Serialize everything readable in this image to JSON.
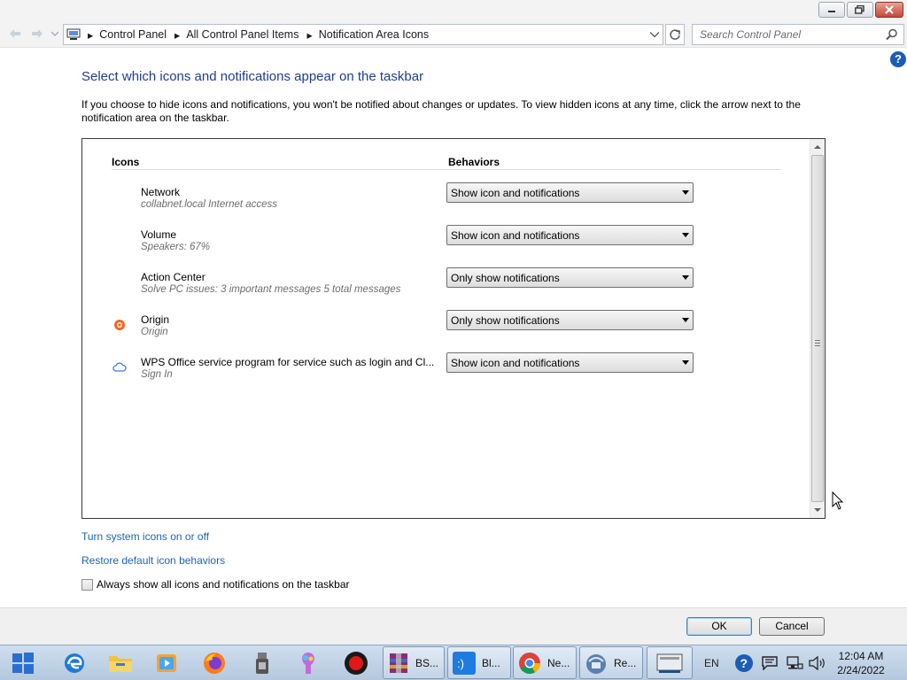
{
  "window": {
    "controls": [
      "minimize",
      "maximize",
      "close"
    ]
  },
  "address_bar": {
    "breadcrumbs": [
      "Control Panel",
      "All Control Panel Items",
      "Notification Area Icons"
    ],
    "search_placeholder": "Search Control Panel"
  },
  "help_label": "?",
  "page": {
    "heading": "Select which icons and notifications appear on the taskbar",
    "description": "If you choose to hide icons and notifications, you won't be notified about changes or updates. To view hidden icons at any time, click the arrow next to the notification area on the taskbar."
  },
  "table": {
    "col_icons": "Icons",
    "col_behaviors": "Behaviors",
    "rows": [
      {
        "name": "Network",
        "sub": "collabnet.local Internet access",
        "behavior": "Show icon and notifications",
        "icon": "none"
      },
      {
        "name": "Volume",
        "sub": "Speakers: 67%",
        "behavior": "Show icon and notifications",
        "icon": "none"
      },
      {
        "name": "Action Center",
        "sub": "Solve PC issues: 3 important messages  5 total messages",
        "behavior": "Only show notifications",
        "icon": "none"
      },
      {
        "name": "Origin",
        "sub": "Origin",
        "behavior": "Only show notifications",
        "icon": "origin-icon"
      },
      {
        "name": "WPS Office service program for service such as login and Cl...",
        "sub": "Sign In",
        "behavior": "Show icon and notifications",
        "icon": "cloud-icon"
      }
    ]
  },
  "links": {
    "system_icons": "Turn system icons on or off",
    "restore_defaults": "Restore default icon behaviors"
  },
  "checkbox": {
    "label": "Always show all icons and notifications on the taskbar",
    "checked": false
  },
  "buttons": {
    "ok": "OK",
    "cancel": "Cancel"
  },
  "taskbar": {
    "pinned": [
      "windows-start-icon",
      "edge-icon",
      "file-explorer-icon",
      "media-player-icon",
      "firefox-icon",
      "usb-device-icon",
      "paint-icon",
      "record-icon"
    ],
    "tasks": [
      {
        "label": "BS...",
        "icon": "winrar-icon"
      },
      {
        "label": "Bl...",
        "icon": "bluetooth-app-icon"
      },
      {
        "label": "Ne...",
        "icon": "chrome-icon"
      },
      {
        "label": "Re...",
        "icon": "remote-desktop-icon"
      },
      {
        "label": "",
        "icon": "console-icon"
      }
    ],
    "language": "EN",
    "time": "12:04 AM",
    "date": "2/24/2022"
  },
  "colors": {
    "heading": "#1e3f8f",
    "link": "#1e64b4",
    "taskbar": "#c3d4e7"
  }
}
